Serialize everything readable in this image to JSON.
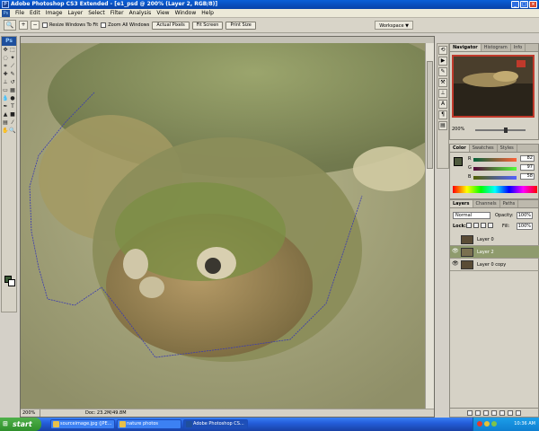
{
  "window": {
    "title": "Adobe Photoshop CS3 Extended - [e1_psd @ 200% (Layer 2, RGB/8)]"
  },
  "menu": {
    "items": [
      "File",
      "Edit",
      "Image",
      "Layer",
      "Select",
      "Filter",
      "Analysis",
      "View",
      "Window",
      "Help"
    ]
  },
  "options": {
    "resize_windows": "Resize Windows To Fit",
    "zoom_all": "Zoom All Windows",
    "actual_pixels": "Actual Pixels",
    "fit_screen": "Fit Screen",
    "print_size": "Print Size",
    "workspace": "Workspace ▼"
  },
  "toolbox": {
    "logo": "Ps"
  },
  "document": {
    "zoom": "200%",
    "doc_size": "Doc: 23.2M/49.8M"
  },
  "navigator": {
    "tabs": [
      "Navigator",
      "Histogram",
      "Info"
    ],
    "zoom": "200%"
  },
  "color": {
    "tabs": [
      "Color",
      "Swatches",
      "Styles"
    ],
    "channels": [
      {
        "label": "R",
        "value": "82"
      },
      {
        "label": "G",
        "value": "97"
      },
      {
        "label": "B",
        "value": "58"
      }
    ]
  },
  "layers": {
    "tabs": [
      "Layers",
      "Channels",
      "Paths"
    ],
    "blend_mode": "Normal",
    "opacity_label": "Opacity:",
    "opacity": "100%",
    "lock_label": "Lock:",
    "fill_label": "Fill:",
    "fill": "100%",
    "items": [
      {
        "name": "Layer 0"
      },
      {
        "name": "Layer 2"
      },
      {
        "name": "Layer 0 copy"
      }
    ]
  },
  "taskbar": {
    "start": "start",
    "tasks": [
      "sourceimage.jpg (JPE...",
      "nature photos",
      "Adobe Photoshop CS..."
    ],
    "clock": "10:36 AM"
  }
}
